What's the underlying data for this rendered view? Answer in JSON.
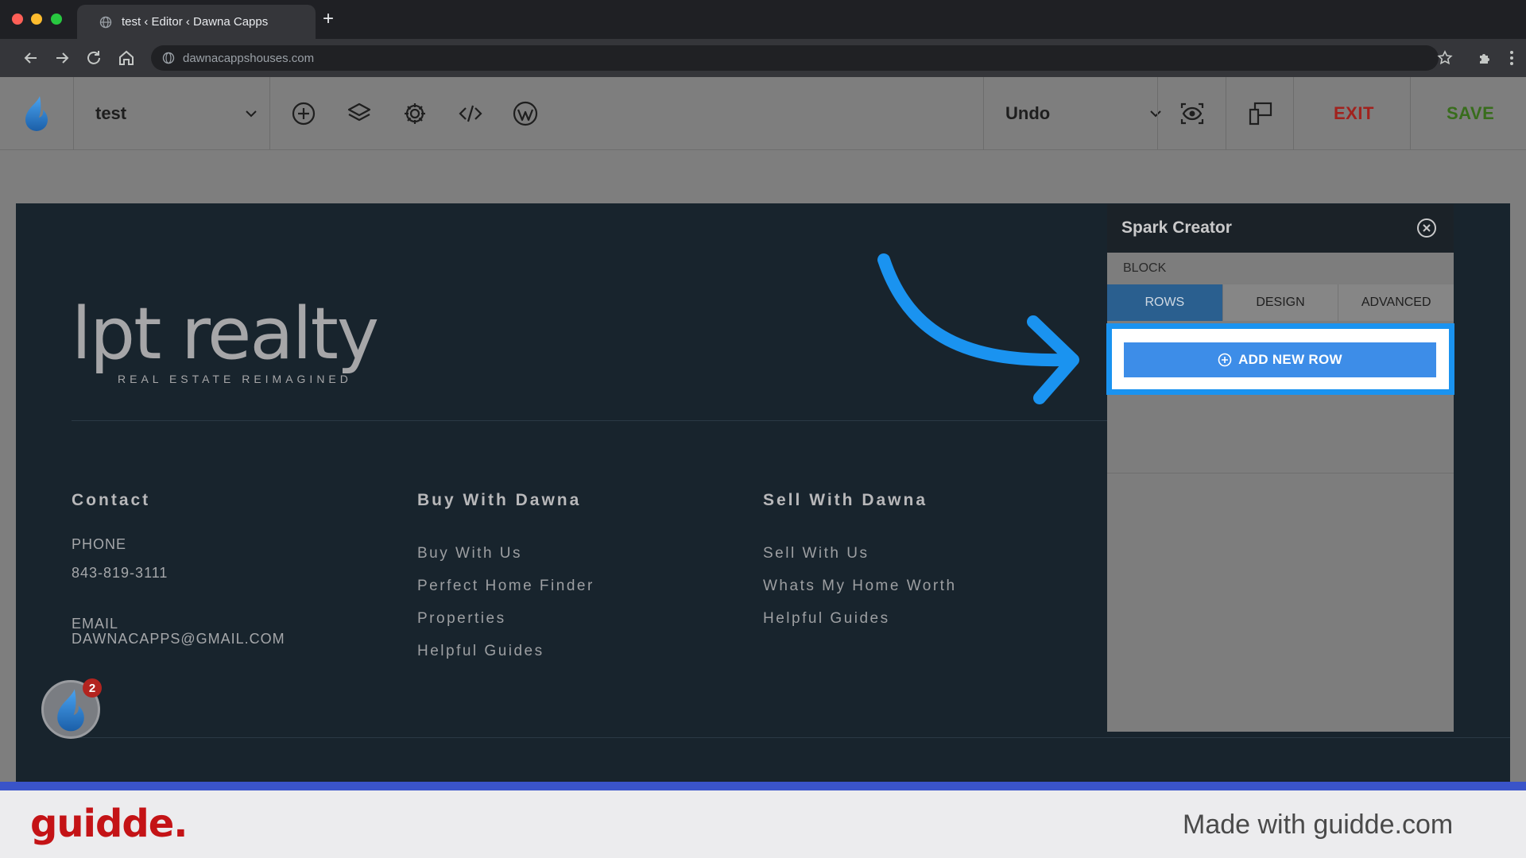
{
  "browser": {
    "tab_title": "test ‹ Editor ‹ Dawna Capps",
    "url": "dawnacappshouses.com"
  },
  "toolbar": {
    "site_name": "test",
    "undo_label": "Undo",
    "exit_label": "EXIT",
    "save_label": "SAVE"
  },
  "footer": {
    "logo_main": "lpt realty",
    "logo_sub": "REAL ESTATE REIMAGINED",
    "contact": {
      "heading": "Contact",
      "phone_label": "PHONE",
      "phone": "843-819-3111",
      "email_label": "EMAIL",
      "email": "DAWNACAPPS@GMAIL.COM"
    },
    "buy": {
      "heading": "Buy With Dawna",
      "links": [
        "Buy With Us",
        "Perfect Home Finder",
        "Properties",
        "Helpful Guides"
      ]
    },
    "sell": {
      "heading": "Sell With Dawna",
      "links": [
        "Sell With Us",
        "Whats My Home Worth",
        "Helpful Guides"
      ]
    },
    "notification_count": "2"
  },
  "panel": {
    "title": "Spark Creator",
    "section_label": "BLOCK",
    "tabs": [
      "ROWS",
      "DESIGN",
      "ADVANCED"
    ],
    "add_row_label": "ADD NEW ROW"
  },
  "guidde": {
    "logo": "guidde.",
    "made_with": "Made with guidde.com"
  },
  "colors": {
    "accent_blue": "#1a93f0",
    "exit_red": "#a1221d",
    "save_green": "#386d1c",
    "footer_bg": "#18242d"
  }
}
